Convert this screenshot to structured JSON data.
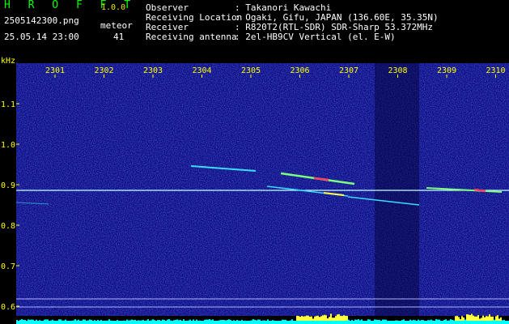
{
  "header": {
    "app_title": "H R O F F T",
    "version": "1.0.0",
    "filename": "2505142300.png",
    "datetime": "25.05.14 23:00",
    "meteor_label": "meteor",
    "meteor_count": "41",
    "info": [
      {
        "key": "Observer",
        "value": ": Takanori Kawachi"
      },
      {
        "key": "Receiving Location",
        "value": ": Ogaki, Gifu, JAPAN (136.60E, 35.35N)"
      },
      {
        "key": "Receiver",
        "value": ": R820T2(RTL-SDR) SDR-Sharp 53.372MHz"
      },
      {
        "key": "Receiving antenna",
        "value": ": 2el-HB9CV Vertical (el. E-W)"
      }
    ]
  },
  "spectrogram": {
    "unit_label": "kHz",
    "time_ticks": [
      "2301",
      "2302",
      "2303",
      "2304",
      "2305",
      "2306",
      "2307",
      "2308",
      "2309",
      "2310"
    ],
    "freq_ticks": [
      "1.1",
      "1.0",
      "0.9",
      "0.8",
      "0.7",
      "0.6"
    ],
    "carrier_khz": 0.89,
    "colors": {
      "background": "#0a0a7a",
      "text": "#ffff00",
      "carrier": "#c8ffff",
      "histogram": "#00ffff"
    }
  }
}
